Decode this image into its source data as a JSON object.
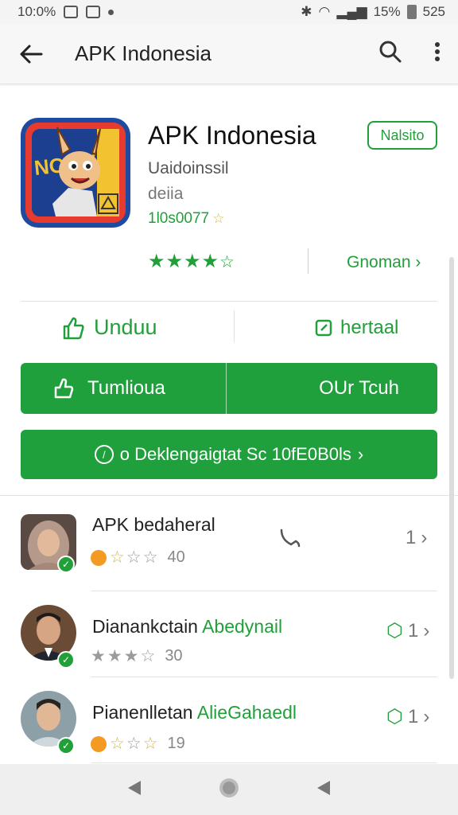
{
  "status": {
    "left_text": "10:0%",
    "signal_text": "15%",
    "time": "525"
  },
  "appbar": {
    "title": "APK Indonesia"
  },
  "app": {
    "name": "APK Indonesia",
    "install_chip": "Nalsito",
    "developer": "Uaidoinssil",
    "category": "deiia",
    "downloads": "1l0s0077",
    "rating_stars": 4,
    "rating_link": "Gnoman",
    "icon_text": "NOIJV"
  },
  "actions": {
    "left_label": "Unduu",
    "right_label": "hertaal"
  },
  "buttons": {
    "split_left": "Tumlioua",
    "split_right": "OUr Tcuh",
    "wide": "o Deklengaigtat Sc 10fE0B0ls"
  },
  "reviews": [
    {
      "name": "APK bedaheral",
      "name_green": "",
      "stars_count": "40",
      "count": "1"
    },
    {
      "name": "Dianankctain",
      "name_green": "Abedynail",
      "stars_count": "30",
      "count": "1"
    },
    {
      "name": "Pianenlletan",
      "name_green": "AlieGahaedl",
      "stars_count": "19",
      "count": "1"
    }
  ],
  "colors": {
    "accent": "#20a03c",
    "star_gold": "#d6b547",
    "orange": "#f29a22"
  }
}
